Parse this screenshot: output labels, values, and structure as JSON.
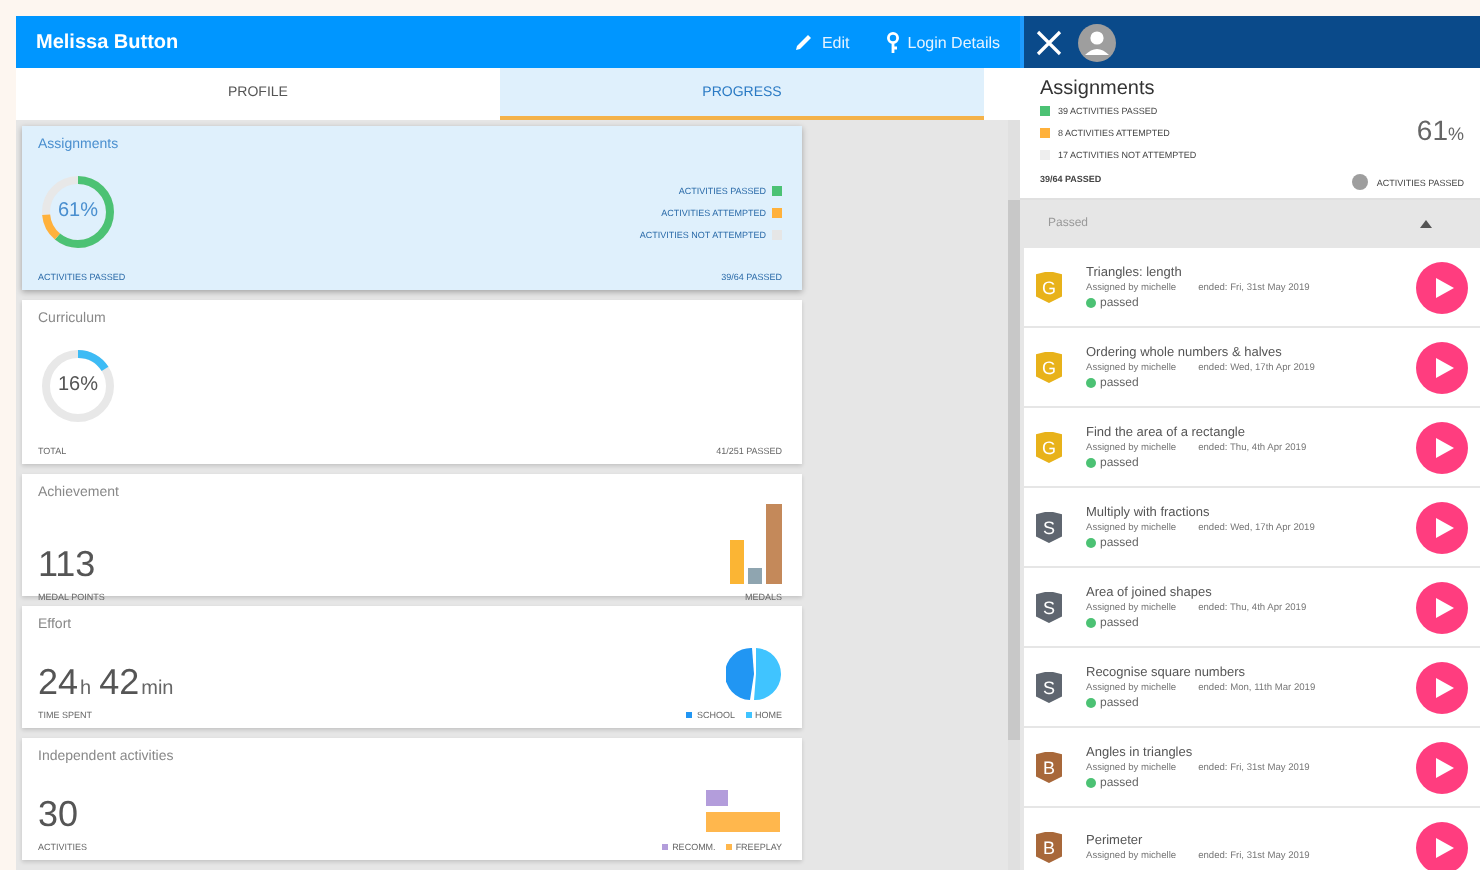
{
  "header": {
    "title": "Melissa Button",
    "actions": [
      {
        "kind": "edit",
        "label": "Edit"
      },
      {
        "kind": "key",
        "label": "Login Details"
      }
    ]
  },
  "tabs": [
    {
      "label": "PROFILE",
      "selected": false
    },
    {
      "label": "PROGRESS",
      "selected": true
    }
  ],
  "cards": [
    {
      "kind": "donut",
      "title": "Assignments",
      "selected": true,
      "value": "61%",
      "ring": [
        {
          "color": "#4cc274",
          "level": 0.61
        },
        {
          "color": "#ffb13b",
          "level": 0.125
        }
      ],
      "legend": [
        {
          "label": "ACTIVITIES PASSED",
          "color": "#4cc274"
        },
        {
          "label": "ACTIVITIES ATTEMPTED",
          "color": "#ffb13b"
        },
        {
          "label": "ACTIVITIES NOT ATTEMPTED",
          "color": "#e6e6e6"
        }
      ],
      "footer_left": "ACTIVITIES PASSED",
      "footer_right": "39/64 PASSED"
    },
    {
      "kind": "donut",
      "title": "Curriculum",
      "selected": false,
      "value": "16%",
      "ring": [
        {
          "color": "#3dbbf5",
          "level": 0.16
        }
      ],
      "footer_left": "TOTAL",
      "footer_right": "41/251 PASSED"
    },
    {
      "kind": "medals",
      "title": "Achievement",
      "selected": false,
      "big": [
        {
          "text": "113"
        }
      ],
      "footer_left": "MEDAL POINTS",
      "legend": [
        {
          "label": "MEDALS"
        }
      ]
    },
    {
      "kind": "pie",
      "title": "Effort",
      "selected": false,
      "big": [
        {
          "text": "24",
          "unit": "h"
        },
        {
          "text": "42",
          "unit": "min"
        }
      ],
      "footer_left": "TIME SPENT",
      "legend": [
        {
          "label": "SCHOOL",
          "color": "#2196f3"
        },
        {
          "label": "HOME",
          "color": "#40c4ff"
        }
      ]
    },
    {
      "kind": "hbars",
      "title": "Independent activities",
      "selected": false,
      "big": [
        {
          "text": "30"
        }
      ],
      "footer_left": "ACTIVITIES",
      "legend": [
        {
          "label": "RECOMM.",
          "color": "#b39ddb"
        },
        {
          "label": "FREEPLAY",
          "color": "#ffb74d"
        }
      ]
    }
  ],
  "panel": {
    "title": "Assignments",
    "legend": [
      {
        "label": "39 ACTIVITIES PASSED",
        "color": "#4cc274"
      },
      {
        "label": "8 ACTIVITIES ATTEMPTED",
        "color": "#ffb13b"
      },
      {
        "label": "17 ACTIVITIES NOT ATTEMPTED",
        "color": "#eeeeee"
      }
    ],
    "percent": "61",
    "percent_unit": "%",
    "passed": "39/64 PASSED",
    "info_label": "ACTIVITIES PASSED",
    "section": {
      "label": "Passed",
      "expanded": true
    },
    "items": [
      {
        "title": "Triangles: length",
        "badge": "G",
        "color": "#e8b21a",
        "assigned": "Assigned by michelle",
        "ended": "ended: Fri, 31st May 2019",
        "status": "passed"
      },
      {
        "title": "Ordering whole numbers & halves",
        "badge": "G",
        "color": "#e8b21a",
        "assigned": "Assigned by michelle",
        "ended": "ended: Wed, 17th Apr 2019",
        "status": "passed"
      },
      {
        "title": "Find the area of a rectangle",
        "badge": "G",
        "color": "#e8b21a",
        "assigned": "Assigned by michelle",
        "ended": "ended: Thu, 4th Apr 2019",
        "status": "passed"
      },
      {
        "title": "Multiply with fractions",
        "badge": "S",
        "color": "#5f6670",
        "assigned": "Assigned by michelle",
        "ended": "ended: Wed, 17th Apr 2019",
        "status": "passed"
      },
      {
        "title": "Area of joined shapes",
        "badge": "S",
        "color": "#5f6670",
        "assigned": "Assigned by michelle",
        "ended": "ended: Thu, 4th Apr 2019",
        "status": "passed"
      },
      {
        "title": "Recognise square numbers",
        "badge": "S",
        "color": "#5f6670",
        "assigned": "Assigned by michelle",
        "ended": "ended: Mon, 11th Mar 2019",
        "status": "passed"
      },
      {
        "title": "Angles in triangles",
        "badge": "B",
        "color": "#a8683a",
        "assigned": "Assigned by michelle",
        "ended": "ended: Fri, 31st May 2019",
        "status": "passed"
      },
      {
        "title": "Perimeter",
        "badge": "B",
        "color": "#a8683a",
        "assigned": "Assigned by michelle",
        "ended": "ended: Fri, 31st May 2019"
      }
    ]
  }
}
